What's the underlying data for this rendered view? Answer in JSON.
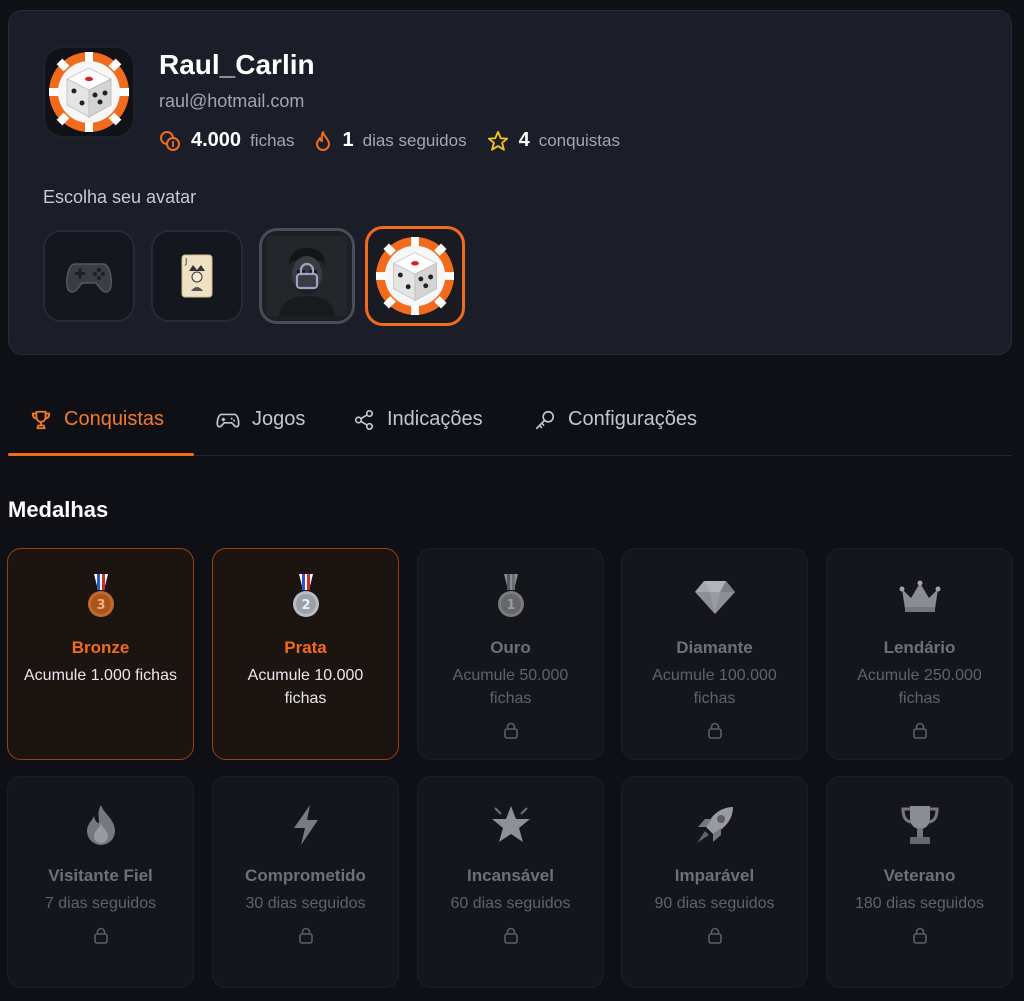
{
  "profile": {
    "username": "Raul_Carlin",
    "email": "raul@hotmail.com",
    "stats": [
      {
        "icon": "coins-icon",
        "value": "4.000",
        "label": "fichas"
      },
      {
        "icon": "flame-icon",
        "value": "1",
        "label": "dias seguidos"
      },
      {
        "icon": "star-icon",
        "value": "4",
        "label": "conquistas"
      }
    ],
    "avatar_section_title": "Escolha seu avatar",
    "avatars": [
      {
        "icon": "gamepad-avatar-icon",
        "state": "available"
      },
      {
        "icon": "joker-card-avatar-icon",
        "state": "available"
      },
      {
        "icon": "man-portrait-avatar-icon",
        "state": "locked"
      },
      {
        "icon": "dice-avatar-icon",
        "state": "selected"
      }
    ]
  },
  "tabs": [
    {
      "label": "Conquistas",
      "icon": "trophy-icon",
      "active": true
    },
    {
      "label": "Jogos",
      "icon": "gamepad-icon",
      "active": false
    },
    {
      "label": "Indicações",
      "icon": "share-icon",
      "active": false
    },
    {
      "label": "Configurações",
      "icon": "key-icon",
      "active": false
    }
  ],
  "medals_title": "Medalhas",
  "medals": [
    {
      "name": "Bronze",
      "desc": "Acumule 1.000 fichas",
      "icon": "bronze-medal-icon",
      "unlocked": true
    },
    {
      "name": "Prata",
      "desc": "Acumule 10.000 fichas",
      "icon": "silver-medal-icon",
      "unlocked": true
    },
    {
      "name": "Ouro",
      "desc": "Acumule 50.000 fichas",
      "icon": "gold-medal-icon",
      "unlocked": false
    },
    {
      "name": "Diamante",
      "desc": "Acumule 100.000 fichas",
      "icon": "diamond-icon",
      "unlocked": false
    },
    {
      "name": "Lendário",
      "desc": "Acumule 250.000 fichas",
      "icon": "crown-icon",
      "unlocked": false
    },
    {
      "name": "Visitante Fiel",
      "desc": "7 dias seguidos",
      "icon": "fire-icon",
      "unlocked": false
    },
    {
      "name": "Comprometido",
      "desc": "30 dias seguidos",
      "icon": "lightning-icon",
      "unlocked": false
    },
    {
      "name": "Incansável",
      "desc": "60 dias seguidos",
      "icon": "burst-star-icon",
      "unlocked": false
    },
    {
      "name": "Imparável",
      "desc": "90 dias seguidos",
      "icon": "rocket-icon",
      "unlocked": false
    },
    {
      "name": "Veterano",
      "desc": "180 dias seguidos",
      "icon": "trophy-cup-icon",
      "unlocked": false
    }
  ],
  "colors": {
    "accent": "#f26b1d",
    "background": "#0f1015",
    "card": "#1b1e28"
  }
}
